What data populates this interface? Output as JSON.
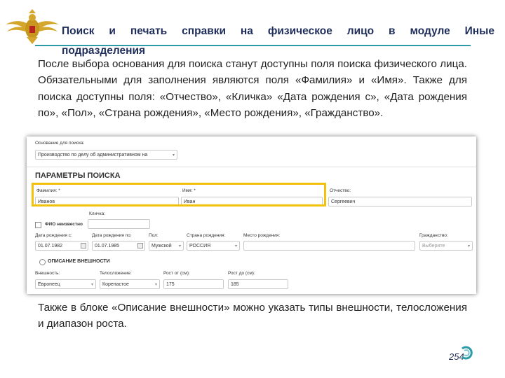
{
  "header": {
    "title_line1": "Поиск и печать справки на физическое лицо в модуле Иные",
    "title_line2": "подразделения"
  },
  "intro_text": "После выбора основания для поиска станут доступны поля поиска физического лица. Обязательными для заполнения являются поля «Фамилия» и «Имя». Также для поиска доступны поля: «Отчество», «Кличка» «Дата рождения с», «Дата рождения по», «Пол», «Страна рождения», «Место рождения», «Гражданство».",
  "outro_text": "Также в блоке «Описание внешности» можно указать типы внешности, телосложения и диапазон роста.",
  "page_number": "254",
  "form": {
    "basis_label": "Основание для поиска:",
    "basis_value": "Производство по делу об административном на",
    "section_title": "ПАРАМЕТРЫ ПОИСКА",
    "surname_label": "Фамилия: *",
    "surname_value": "Иванов",
    "name_label": "Имя: *",
    "name_value": "Иван",
    "patronymic_label": "Отчество:",
    "patronymic_value": "Сергеевич",
    "nickname_label": "Кличка:",
    "nickname_value": "",
    "fio_unknown_label": "ФИО неизвестно",
    "dob_from_label": "Дата рождения с:",
    "dob_from_value": "01.07.1982",
    "dob_to_label": "Дата рождения по:",
    "dob_to_value": "01.07.1985",
    "sex_label": "Пол:",
    "sex_value": "Мужской",
    "birth_country_label": "Страна рождения:",
    "birth_country_value": "РОССИЯ",
    "birth_place_label": "Место рождения:",
    "birth_place_value": "",
    "citizenship_label": "Гражданство:",
    "citizenship_placeholder": "Выберите",
    "appearance_section": "ОПИСАНИЕ ВНЕШНОСТИ",
    "appearance_label": "Внешность:",
    "appearance_value": "Европеец",
    "build_label": "Телосложение:",
    "build_value": "Коренастое",
    "height_from_label": "Рост от (см):",
    "height_from_value": "175",
    "height_to_label": "Рост до (см):",
    "height_to_value": "185"
  },
  "colors": {
    "title": "#1f2d5a",
    "rule": "#2d9aa8",
    "highlight": "#f3c10b"
  },
  "icons": [
    "emblem-icon",
    "calendar-icon",
    "dropdown-arrow-icon",
    "checkbox-icon",
    "radio-icon",
    "swirl-icon"
  ]
}
